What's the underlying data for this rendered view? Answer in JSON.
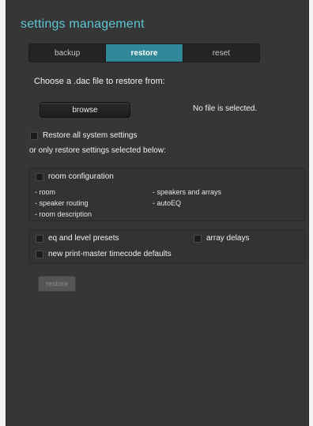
{
  "header": {
    "title": "settings management"
  },
  "tabs": [
    {
      "label": "backup",
      "active": false
    },
    {
      "label": "restore",
      "active": true
    },
    {
      "label": "reset",
      "active": false
    }
  ],
  "restore": {
    "prompt": "Choose a .dac file to restore from:",
    "browse_label": "browse",
    "file_status": "No file is selected.",
    "all_settings_label": "Restore all system settings",
    "or_label": "or only restore settings selected below:",
    "room_config": {
      "label": "room configuration",
      "items": [
        "- room",
        "- speaker routing",
        "- room description",
        "- speakers and arrays",
        "- autoEQ"
      ]
    },
    "eq_label": "eq and level presets",
    "array_delays_label": "array delays",
    "timecode_label": "new print-master timecode defaults",
    "restore_button_label": "restore"
  },
  "colors": {
    "accent": "#5fc4d4",
    "active_tab": "#2f8797",
    "panel": "#363636"
  }
}
